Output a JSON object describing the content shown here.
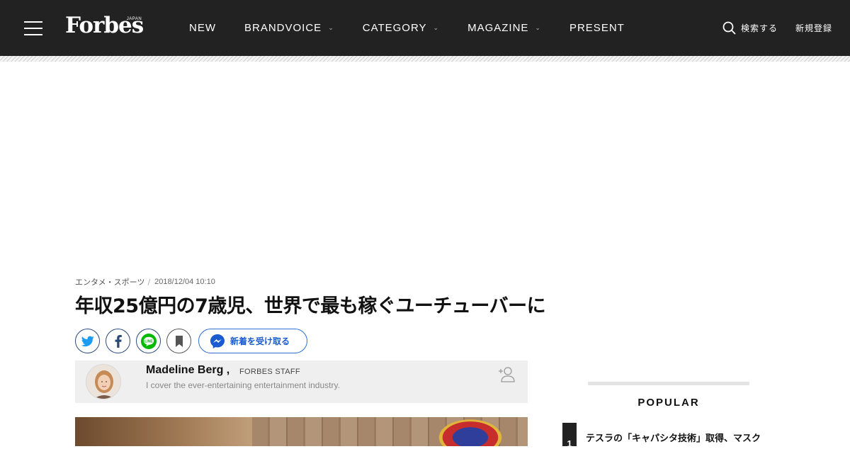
{
  "header": {
    "logo": "Forbes",
    "logo_sub": "JAPAN",
    "nav": [
      {
        "label": "NEW",
        "has_dropdown": false
      },
      {
        "label": "BRANDVOICE",
        "has_dropdown": true
      },
      {
        "label": "CATEGORY",
        "has_dropdown": true
      },
      {
        "label": "MAGAZINE",
        "has_dropdown": true
      },
      {
        "label": "PRESENT",
        "has_dropdown": false
      }
    ],
    "search_label": "検索する",
    "register_label": "新規登録"
  },
  "article": {
    "category": "エンタメ・スポーツ",
    "separator": "/",
    "date": "2018/12/04 10:10",
    "title": "年収25億円の7歳児、世界で最も稼ぐユーチューバーに",
    "share": {
      "follow_label": "新着を受け取る"
    },
    "author": {
      "name": "Madeline Berg ,",
      "role": "FORBES STAFF",
      "bio": "I cover the ever-entertaining entertainment industry."
    }
  },
  "sidebar": {
    "popular_title": "POPULAR",
    "items": [
      {
        "rank": "1",
        "title": "テスラの「キャパシタ技術」取得、マスク"
      }
    ]
  },
  "colors": {
    "header_bg": "#222222",
    "share_border": "#2a4a7a",
    "follow_blue": "#2e6fd8",
    "line_green": "#00b900"
  }
}
